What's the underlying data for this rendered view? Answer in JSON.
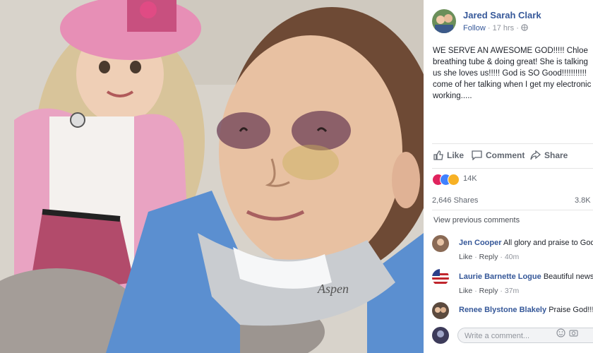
{
  "post": {
    "author": "Jared Sarah Clark",
    "follow_label": "Follow",
    "dot": "·",
    "time": "17 hrs",
    "privacy": "·",
    "text_lines": [
      "WE SERVE AN AWESOME GOD!!!!! Chloe",
      "breathing tube & doing great! She is talking",
      "us she loves us!!!!! God is SO Good!!!!!!!!!!!",
      "come of her talking when I get my electronic",
      "working....."
    ]
  },
  "actions": {
    "like": "Like",
    "comment": "Comment",
    "share": "Share"
  },
  "reactions": {
    "count": "14K",
    "colors": [
      "#e0245e",
      "#4080ff",
      "#f7b125"
    ]
  },
  "stats": {
    "shares": "2,646 Shares",
    "views": "3.8K"
  },
  "view_previous": "View previous comments",
  "comments": [
    {
      "name": "Jen Cooper",
      "text": "All glory and praise to God",
      "like": "Like",
      "reply": "Reply",
      "sep": "·",
      "time": "40m"
    },
    {
      "name": "Laurie Barnette Logue",
      "text": "Beautiful news!",
      "like": "Like",
      "reply": "Reply",
      "sep": "·",
      "time": "37m"
    },
    {
      "name": "Renee Blystone Blakely",
      "text": "Praise God!!!",
      "like": "",
      "reply": "",
      "sep": "",
      "time": ""
    }
  ],
  "write_placeholder": "Write a comment..."
}
